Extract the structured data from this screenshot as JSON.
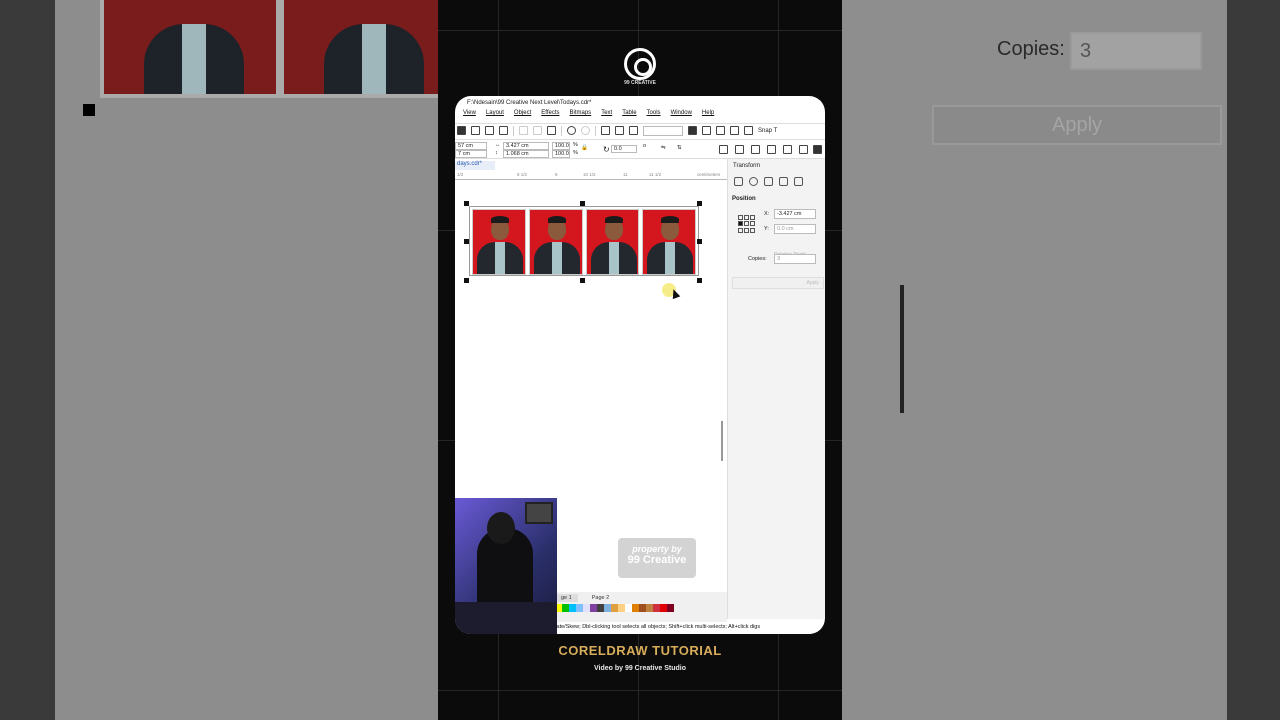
{
  "title_path": "F:\\Ndesain\\99 Creative Next Level\\Todays.cdr*",
  "logo_text": "99 CREATIVE",
  "menu": [
    "View",
    "Layout",
    "Object",
    "Effects",
    "Bitmaps",
    "Text",
    "Table",
    "Tools",
    "Window",
    "Help"
  ],
  "toolbar": {
    "snap_label": "Snap T"
  },
  "properties": {
    "pos_x_partial": "57 cm",
    "pos_y_partial": "7 cm",
    "width": "3.427 cm",
    "height": "1.068 cm",
    "scale_w": "100.0",
    "scale_h": "100.0",
    "percent": "%",
    "rotation": "0.0",
    "deg": "o"
  },
  "doc_tab": "days.cdr*",
  "ruler_unit": "centimeters",
  "ruler_labels": [
    "1/2",
    "8 1/2",
    "9",
    "10 1/2",
    "11",
    "11 1/2"
  ],
  "docker": {
    "title": "Transform",
    "section": "Position",
    "x_label": "X:",
    "x_value": "-3.427 cm",
    "y_label": "Y:",
    "y_value": "0.0 cm",
    "relative": "Relative Positi",
    "copies_label": "Copies:",
    "copies_value": "3",
    "apply": "Apply"
  },
  "pages": [
    "ge 1",
    "Page 2"
  ],
  "status_hint": "tate/Skew; Dbl-clicking tool selects all objects; Shift+click multi-selects; Alt+click digs",
  "watermark": {
    "line1": "property by",
    "line2": "99 Creative"
  },
  "caption": {
    "title": "CORELDRAW TUTORIAL",
    "subtitle": "Video by 99 Creative Studio"
  },
  "background_zoom": {
    "copies_label": "Copies:",
    "copies_value": "3",
    "apply": "Apply"
  },
  "palette_colors": [
    "#ffff00",
    "#00c000",
    "#00c0ff",
    "#80c0ff",
    "#e0e0ff",
    "#8040a0",
    "#404040",
    "#80b0e0",
    "#e0a040",
    "#ffd080",
    "#ffffff",
    "#e08000",
    "#a05020",
    "#c08040",
    "#d03040",
    "#e00000",
    "#800020"
  ],
  "accent_color": "#d8ad5a"
}
